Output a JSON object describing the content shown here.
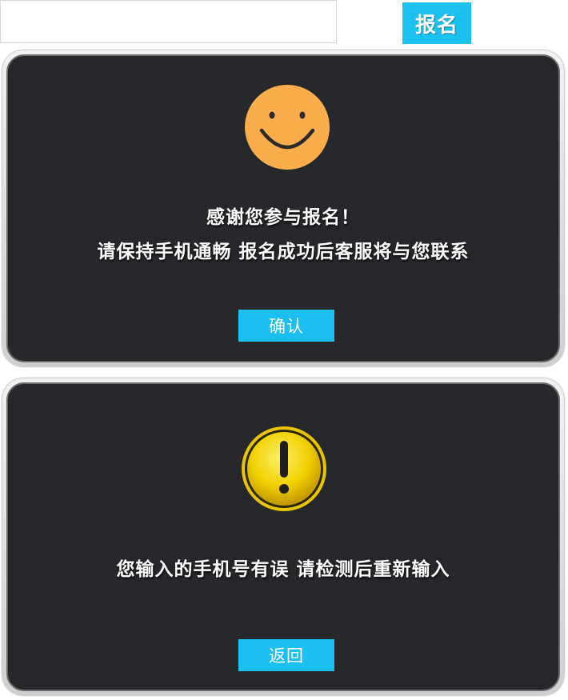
{
  "topbar": {
    "phone_input_value": "",
    "phone_input_placeholder": "",
    "signup_label": "报名"
  },
  "success_dialog": {
    "icon": "smiley-face-icon",
    "line1": "感谢您参与报名！",
    "line2": "请保持手机通畅 报名成功后客服将与您联系",
    "confirm_label": "确认"
  },
  "error_dialog": {
    "icon": "exclamation-warning-icon",
    "message": "您输入的手机号有误 请检测后重新输入",
    "back_label": "返回"
  },
  "colors": {
    "accent": "#1dc1ef",
    "dialog_bg": "#25272a",
    "smiley": "#f9ae4b",
    "warning": "#f0d100"
  }
}
